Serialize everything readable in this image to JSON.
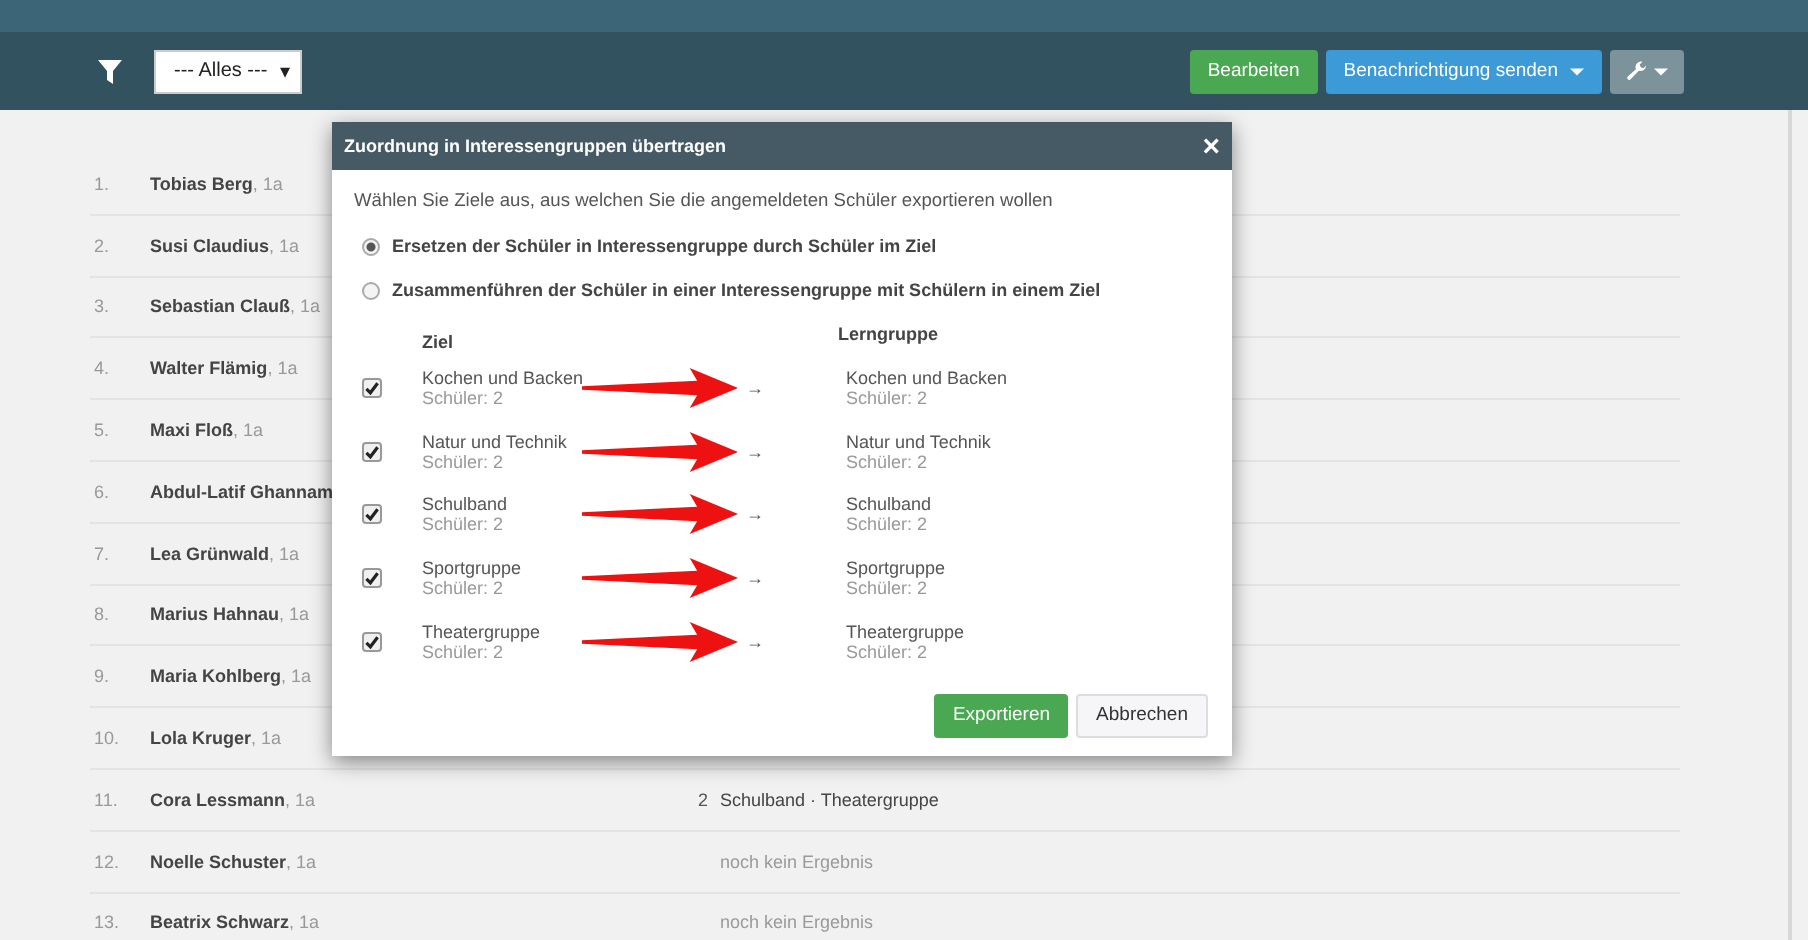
{
  "toolbar": {
    "filter_select": {
      "value": "--- Alles ---",
      "caret": "▾"
    },
    "buttons": [
      {
        "label": "Bearbeiten",
        "kind": "success"
      },
      {
        "label": "Benachrichtigung senden",
        "kind": "primary"
      },
      {
        "kind": "tools"
      }
    ]
  },
  "students": [
    {
      "number": "1.",
      "name": "Tobias Berg",
      "class": ", 1a"
    },
    {
      "number": "2.",
      "name": "Susi Claudius",
      "class": ", 1a"
    },
    {
      "number": "3.",
      "name": "Sebastian Clauß",
      "class": ", 1a"
    },
    {
      "number": "4.",
      "name": "Walter Flämig",
      "class": ", 1a"
    },
    {
      "number": "5.",
      "name": "Maxi Floß",
      "class": ", 1a"
    },
    {
      "number": "6.",
      "name": "Abdul-Latif Ghannam"
    },
    {
      "number": "7.",
      "name": "Lea Grünwald",
      "class": ", 1a"
    },
    {
      "number": "8.",
      "name": "Marius Hahnau",
      "class": ", 1a"
    },
    {
      "number": "9.",
      "name": "Maria Kohlberg",
      "class": ", 1a"
    },
    {
      "number": "10.",
      "name": "Lola Kruger",
      "class": ", 1a"
    },
    {
      "number": "11.",
      "name": "Cora Lessmann",
      "class": ", 1a",
      "count": "2",
      "result": "Schulband · Theatergruppe",
      "has_result": true
    },
    {
      "number": "12.",
      "name": "Noelle Schuster",
      "class": ", 1a",
      "result": "noch kein Ergebnis",
      "has_result": false
    },
    {
      "number": "13.",
      "name": "Beatrix Schwarz",
      "class": ", 1a",
      "result": "noch kein Ergebnis",
      "has_result": false
    }
  ],
  "dialog": {
    "title": "Zuordnung in Interessengruppen übertragen",
    "close": "×",
    "intro": "Wählen Sie Ziele aus, aus welchen Sie die angemeldeten Schüler exportieren wollen",
    "options": [
      {
        "label": "Ersetzen der Schüler in Interessengruppe durch Schüler im Ziel",
        "selected": true
      },
      {
        "label": "Zusammenführen der Schüler in einer Interessengruppe mit Schülern in einem Ziel",
        "selected": false
      }
    ],
    "columns": [
      "Ziel",
      "Lerngruppe"
    ],
    "rows": [
      {
        "checked": true,
        "source": "Kochen und Backen",
        "source_count": "Schüler: 2",
        "arrow": "→",
        "target": "Kochen und Backen",
        "target_count": "Schüler: 2"
      },
      {
        "checked": true,
        "source": "Natur und Technik",
        "source_count": "Schüler: 2",
        "arrow": "→",
        "target": "Natur und Technik",
        "target_count": "Schüler: 2"
      },
      {
        "checked": true,
        "source": "Schulband",
        "source_count": "Schüler: 2",
        "arrow": "→",
        "target": "Schulband",
        "target_count": "Schüler: 2"
      },
      {
        "checked": true,
        "source": "Sportgruppe",
        "source_count": "Schüler: 2",
        "arrow": "→",
        "target": "Sportgruppe",
        "target_count": "Schüler: 2"
      },
      {
        "checked": true,
        "source": "Theatergruppe",
        "source_count": "Schüler: 2",
        "arrow": "→",
        "target": "Theatergruppe",
        "target_count": "Schüler: 2"
      }
    ],
    "buttons": [
      {
        "label": "Exportieren",
        "kind": "success"
      },
      {
        "label": "Abbrechen",
        "kind": "default"
      }
    ]
  }
}
